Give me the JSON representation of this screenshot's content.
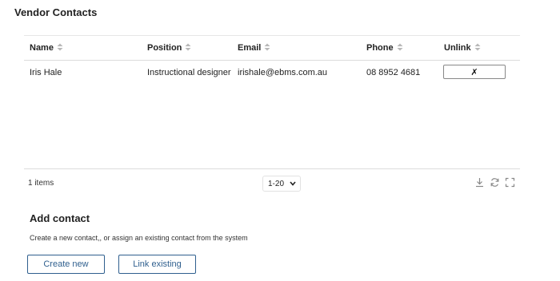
{
  "vendor_contacts": {
    "title": "Vendor Contacts",
    "columns": [
      {
        "label": "Name"
      },
      {
        "label": "Position"
      },
      {
        "label": "Email"
      },
      {
        "label": "Phone"
      },
      {
        "label": "Unlink"
      }
    ],
    "rows": [
      {
        "name": "Iris Hale",
        "position": "Instructional designer",
        "email": "irishale@ebms.com.au",
        "phone": "08 8952 4681",
        "unlink_label": "✗"
      }
    ],
    "footer": {
      "items_count": "1 items",
      "page_size": "1-20",
      "icons": [
        "download-icon",
        "refresh-icon",
        "fullscreen-icon"
      ]
    }
  },
  "add_contact": {
    "title": "Add contact",
    "description": "Create a new contact,, or assign an existing contact from the system",
    "create_button": "Create new",
    "link_button": "Link existing"
  },
  "colors": {
    "button_border": "#2f5f8e",
    "divider": "#dcdcdc",
    "sort_icon": "#b8b8b8"
  }
}
